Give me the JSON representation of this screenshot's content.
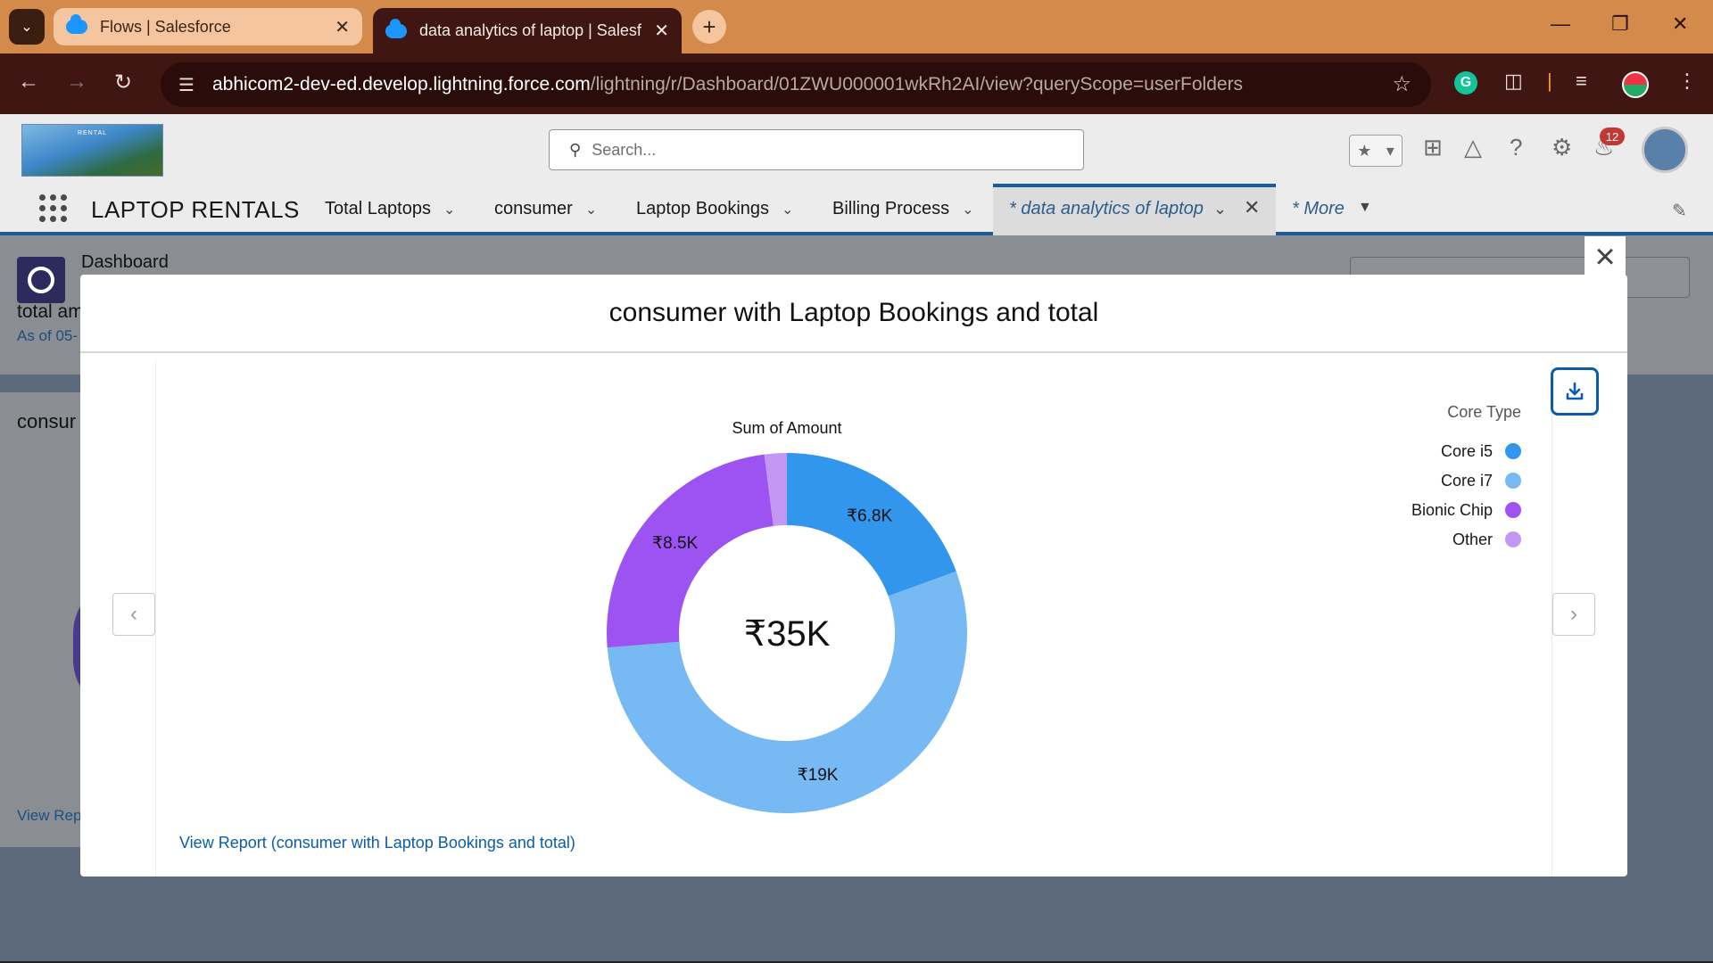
{
  "browser": {
    "tabs": [
      {
        "title": "Flows | Salesforce"
      },
      {
        "title": "data analytics of laptop | Salesf"
      }
    ],
    "url_host": "abhicom2-dev-ed.develop.lightning.force.com",
    "url_path": "/lightning/r/Dashboard/01ZWU000001wkRh2AI/view?queryScope=userFolders"
  },
  "header": {
    "search_placeholder": "Search...",
    "notification_count": "12"
  },
  "appnav": {
    "app_name": "LAPTOP RENTALS",
    "items": [
      {
        "label": "Total Laptops"
      },
      {
        "label": "consumer"
      },
      {
        "label": "Laptop Bookings"
      },
      {
        "label": "Billing Process"
      }
    ],
    "active_tab": "* data analytics of laptop",
    "more": "* More"
  },
  "dashboard": {
    "label": "Dashboard",
    "title_partial": "total am",
    "asof_partial": "As of 05-",
    "card_title_partial": "consur",
    "card_link_partial": "View Rep"
  },
  "modal": {
    "title": "consumer with Laptop Bookings and total",
    "view_report": "View Report (consumer with Laptop Bookings and total)"
  },
  "chart_data": {
    "type": "pie",
    "subtitle": "Sum of Amount",
    "center_label": "₹35K",
    "legend_title": "Core Type",
    "legend_position": "top-right",
    "series": [
      {
        "name": "Core i5",
        "value": 6800,
        "label": "₹6.8K",
        "color": "#3296ed"
      },
      {
        "name": "Core i7",
        "value": 19000,
        "label": "₹19K",
        "color": "#77b9f2"
      },
      {
        "name": "Bionic Chip",
        "value": 8500,
        "label": "₹8.5K",
        "color": "#9d53f2"
      },
      {
        "name": "Other",
        "value": 700,
        "label": "",
        "color": "#c398f5"
      }
    ]
  }
}
